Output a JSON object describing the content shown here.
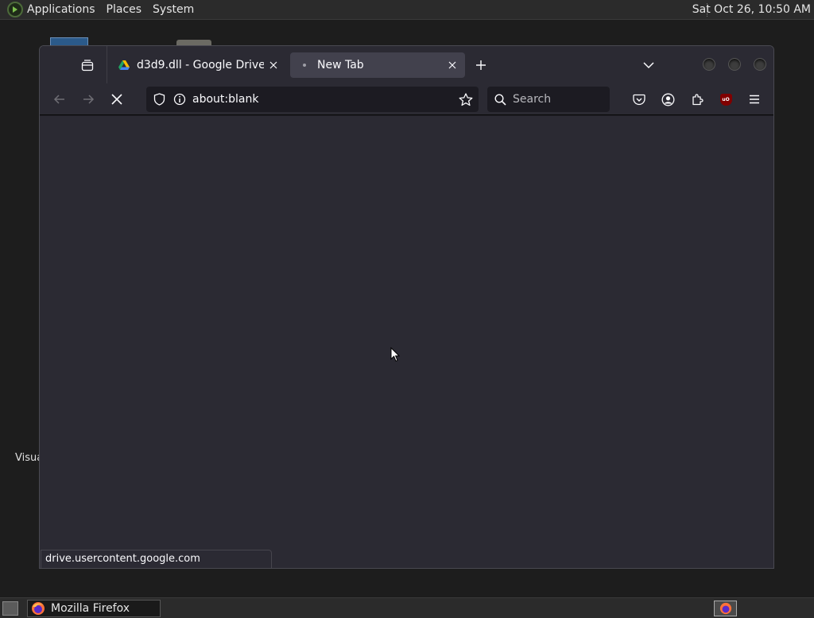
{
  "top_panel": {
    "menus": [
      "Applications",
      "Places",
      "System"
    ],
    "clock": "Sat Oct 26, 10:50 AM"
  },
  "desktop": {
    "partial_label": "Visua"
  },
  "browser": {
    "tabs": [
      {
        "title": "d3d9.dll - Google Drive",
        "favicon": "google-drive-icon",
        "active": false
      },
      {
        "title": "New Tab",
        "favicon": "loading-dot-icon",
        "active": true
      }
    ],
    "url": "about:blank",
    "search_placeholder": "Search",
    "status_text": "drive.usercontent.google.com",
    "theme": {
      "background": "#2b2a33",
      "text": "#fbfbfe"
    }
  },
  "taskbar": {
    "items": [
      {
        "label": "Mozilla Firefox",
        "icon": "firefox-icon"
      }
    ]
  }
}
